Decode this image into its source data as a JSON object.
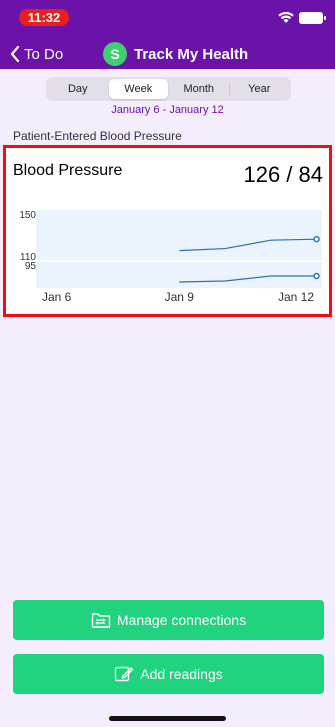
{
  "status_bar": {
    "time": "11:32"
  },
  "nav": {
    "back_label": "To Do",
    "avatar_letter": "S",
    "title": "Track My Health"
  },
  "segments": [
    {
      "label": "Day",
      "active": false
    },
    {
      "label": "Week",
      "active": true
    },
    {
      "label": "Month",
      "active": false
    },
    {
      "label": "Year",
      "active": false
    }
  ],
  "date_range": "January 6 - January 12",
  "section_label": "Patient-Entered Blood Pressure",
  "card": {
    "title": "Blood Pressure",
    "value": "126 / 84"
  },
  "colors": {
    "brand": "#6b12a8",
    "accent": "#21d27f",
    "line": "#2a6fb8",
    "band": "#ebf3fc",
    "highlight": "#e8101a"
  },
  "chart_data": {
    "type": "line",
    "x": [
      "Jan 6",
      "Jan 7",
      "Jan 8",
      "Jan 9",
      "Jan 10",
      "Jan 11",
      "Jan 12"
    ],
    "x_tick_labels": [
      "Jan 6",
      "Jan 9",
      "Jan 12"
    ],
    "series": [
      {
        "values": [
          null,
          null,
          null,
          115,
          117,
          125,
          126
        ]
      },
      {
        "values": [
          null,
          null,
          null,
          78,
          79,
          84,
          84
        ]
      }
    ],
    "upper_panel": {
      "tick_labels": [
        "150",
        "110"
      ],
      "range": [
        106,
        154
      ]
    },
    "lower_panel": {
      "tick_labels": [
        "95"
      ],
      "range": [
        72,
        98
      ]
    }
  },
  "buttons": {
    "manage_connections": "Manage connections",
    "add_readings": "Add readings"
  }
}
